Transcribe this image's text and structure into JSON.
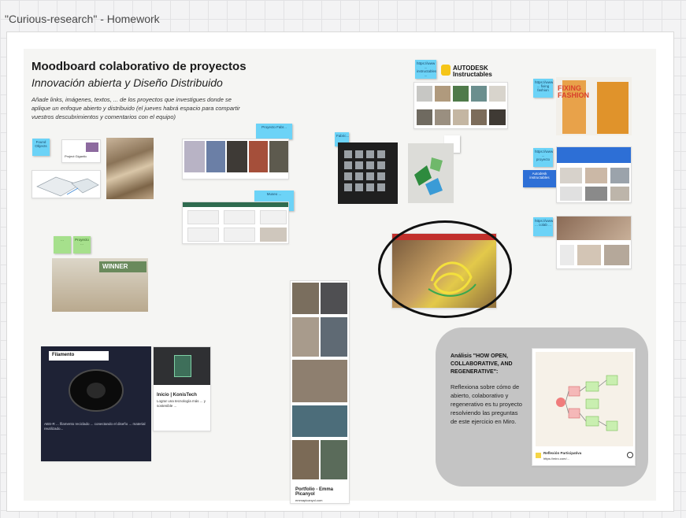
{
  "board": {
    "title": "\"Curious-research\" - Homework"
  },
  "header": {
    "title": "Moodboard colaborativo de proyectos",
    "subtitle": "Innovación abierta y Diseño Distribuido",
    "description": "Añade links, imágenes, textos, ... de los proyectos que investigues donde se aplique un enfoque abierto y distribuido (el jueves habrá espacio para compartir vuestros descubrimientos y comentarios con el equipo)"
  },
  "stickies": {
    "found_objects": "Found Objects",
    "project_gigantic": "Project Gigantic",
    "s_top_mid": "Proyecto Fabr...",
    "s_mid": "Museo ...",
    "s_fabric": "Fabric...",
    "s_green1": "...",
    "s_green2": "Proyecto ...",
    "s_instructables": "https://www ... instructables ...",
    "s_fixing": "https://www ... fixing fashion",
    "s_right2": "https://www ... proyecto",
    "s_right3": "https://www ... colab ...",
    "s_blue_label": "Autodesk instructables"
  },
  "logos": {
    "autodesk": "AUTODESK Instructables"
  },
  "cards": {
    "filamento_label": "Filamento",
    "filamento_body": "ABS-R ... filamento reciclado ... conectando el diseño ... material reutilizado...",
    "konistech_title": "Inicio | KonisTech",
    "konistech_body": "Lograr una tecnología más ... y sostenible ...",
    "portfolio_title": "Portfolio - Emma Picanyol",
    "portfolio_url": "emmapicanyol.com",
    "winner_label": "WINNER",
    "fixing_fashion": "FIXING FASHION"
  },
  "analysis": {
    "title": "Análisis \"HOW OPEN, COLLABORATIVE, AND REGENERATIVE\":",
    "body": "Reflexiona sobre cómo de abierto, colaborativo y regenerativo es tu proyecto resolviendo las preguntas de este ejercicio en Miro.",
    "card_caption": "Reflexión Participativa",
    "card_url": "https://miro.com/..."
  },
  "colors": {
    "sticky_blue": "#6cd3f7",
    "sticky_green": "#a6e08c",
    "analysis_bg": "#c4c4c4"
  }
}
